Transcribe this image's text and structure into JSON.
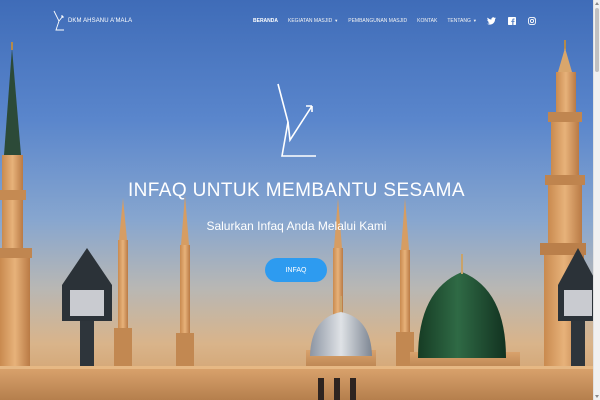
{
  "brand": {
    "name": "DKM AHSANU A'MALA",
    "logo_icon": "dkm-logo-icon"
  },
  "nav": {
    "items": [
      {
        "label": "BERANDA",
        "active": true,
        "dropdown": false
      },
      {
        "label": "KEGIATAN MASJID",
        "active": false,
        "dropdown": true
      },
      {
        "label": "PEMBANGUNAN MASJID",
        "active": false,
        "dropdown": false
      },
      {
        "label": "KONTAK",
        "active": false,
        "dropdown": false
      },
      {
        "label": "TENTANG",
        "active": false,
        "dropdown": true
      }
    ],
    "social": [
      "twitter-icon",
      "facebook-icon",
      "instagram-icon"
    ]
  },
  "hero": {
    "title": "INFAQ UNTUK MEMBANTU SESAMA",
    "subtitle": "Salurkan Infaq Anda Melalui Kami",
    "cta_label": "INFAQ",
    "background": "mosque-domes-minarets-photo"
  },
  "colors": {
    "accent": "#2d9bf0",
    "dome": "#1e4d2f",
    "text": "#ffffff"
  }
}
